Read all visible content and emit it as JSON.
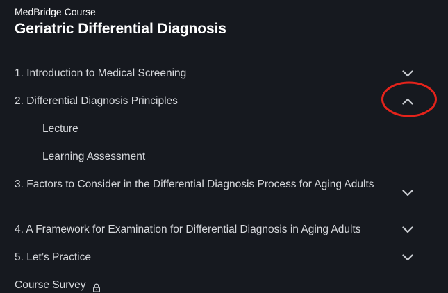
{
  "course": {
    "eyebrow": "MedBridge Course",
    "title": "Geriatric Differential Diagnosis"
  },
  "modules": [
    {
      "label": "1. Introduction to Medical Screening",
      "expanded": false,
      "chevron_icon": "chevron-down-icon"
    },
    {
      "label": "2. Differential Diagnosis Principles",
      "expanded": true,
      "chevron_icon": "chevron-up-icon",
      "items": [
        {
          "label": "Lecture"
        },
        {
          "label": "Learning Assessment"
        }
      ]
    },
    {
      "label": "3. Factors to Consider in the Differential Diagnosis Process for Aging Adults",
      "expanded": false,
      "chevron_icon": "chevron-down-icon"
    },
    {
      "label": "4. A Framework for Examination for Differential Diagnosis in Aging Adults",
      "expanded": false,
      "chevron_icon": "chevron-down-icon"
    },
    {
      "label": "5. Let’s Practice",
      "expanded": false,
      "chevron_icon": "chevron-down-icon"
    }
  ],
  "survey": {
    "label": "Course Survey",
    "locked": true,
    "icon": "lock-icon"
  },
  "annotation": {
    "shape": "ellipse",
    "color": "#e5231b",
    "target": "module-2-chevron"
  },
  "colors": {
    "background": "#16191f",
    "text": "#d6d8dc",
    "title": "#ffffff",
    "chevron": "#c9ccd1"
  }
}
